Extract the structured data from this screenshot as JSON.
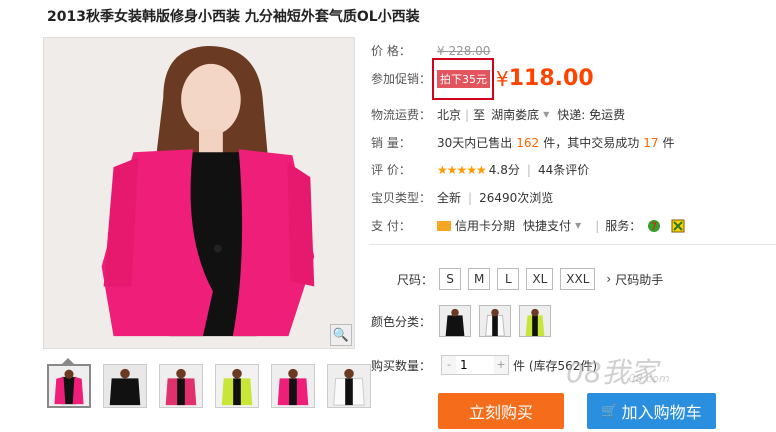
{
  "product": {
    "title": "2013秋季女装韩版修身小西装 九分袖短外套气质OL小西装"
  },
  "price": {
    "label": "价  格：",
    "original": "¥ 228.00"
  },
  "promo": {
    "label": "参加促销：",
    "tag": "拍下35元",
    "yen": "¥",
    "price": "118.00"
  },
  "shipping": {
    "label": "物流运费：",
    "from": "北京",
    "to_prefix": "至",
    "to": "湖南娄底",
    "fee": "快递: 免运费"
  },
  "sales": {
    "label": "销  量：",
    "text1": "30天内已售出",
    "count": "162",
    "text2": "件，其中交易成功",
    "success": "17",
    "text3": "件"
  },
  "rating": {
    "label": "评  价：",
    "stars": "★★★★★",
    "score": "4.8分",
    "reviews": "44条评价"
  },
  "info": {
    "label": "宝贝类型：",
    "type": "全新",
    "views": "26490次浏览"
  },
  "payment": {
    "label": "支  付：",
    "method1": "信用卡分期",
    "method2": "快捷支付",
    "service_label": "服务："
  },
  "sizes": {
    "label": "尺码：",
    "options": [
      "S",
      "M",
      "L",
      "XL",
      "XXL"
    ],
    "help": "尺码助手"
  },
  "colors": {
    "label": "颜色分类："
  },
  "quantity": {
    "label": "购买数量：",
    "minus": "-",
    "value": "1",
    "plus": "+",
    "stock": "件 (库存562件)"
  },
  "actions": {
    "buy": "立刻购买",
    "cart": "加入购物车"
  },
  "watermark": {
    "main": "08我家",
    "sub": "08.com"
  },
  "colors_theme": {
    "accent": "#ff4400",
    "buy_button": "#f56c1a",
    "cart_button": "#2b8fe0",
    "highlight_box": "#d0021b"
  }
}
